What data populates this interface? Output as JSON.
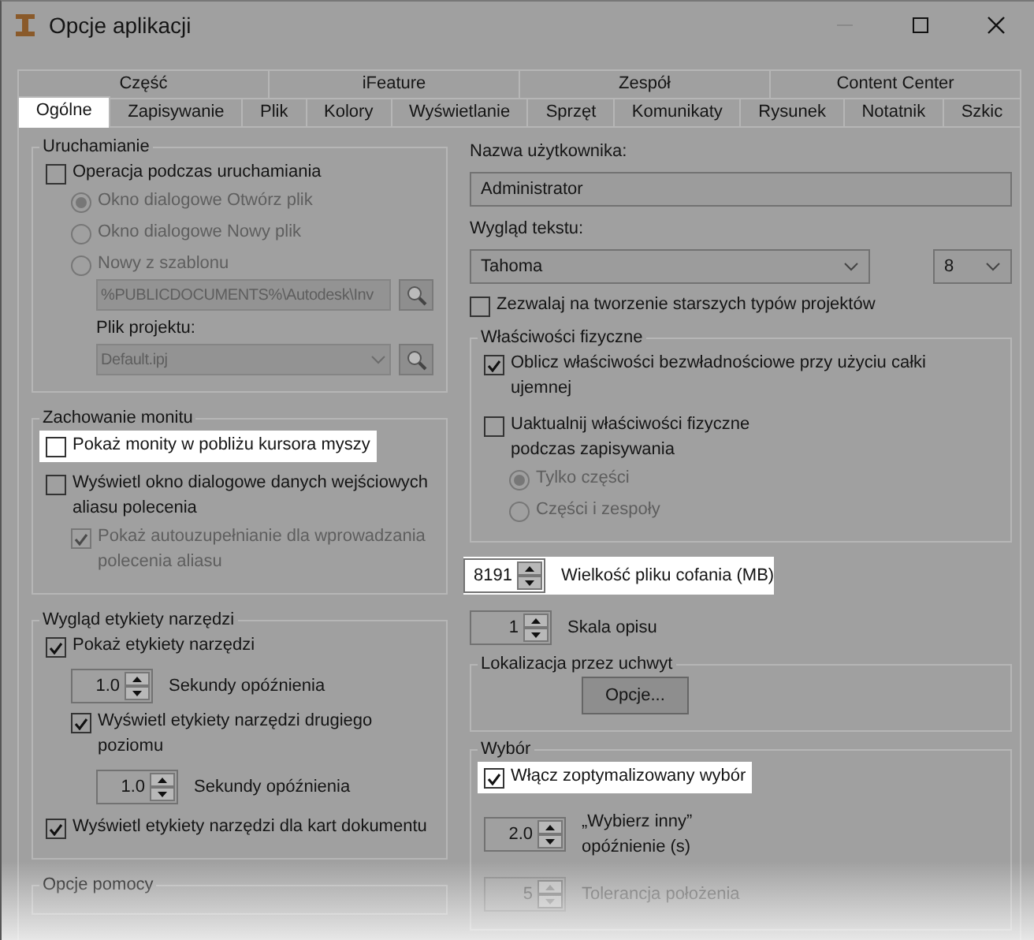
{
  "window": {
    "title": "Opcje aplikacji"
  },
  "tab_rows": [
    [
      {
        "label": "Część",
        "selected": false
      },
      {
        "label": "iFeature",
        "selected": false
      },
      {
        "label": "Zespół",
        "selected": false
      },
      {
        "label": "Content Center",
        "selected": false
      }
    ],
    [
      {
        "label": "Ogólne",
        "selected": true
      },
      {
        "label": "Zapisywanie",
        "selected": false
      },
      {
        "label": "Plik",
        "selected": false
      },
      {
        "label": "Kolory",
        "selected": false
      },
      {
        "label": "Wyświetlanie",
        "selected": false
      },
      {
        "label": "Sprzęt",
        "selected": false
      },
      {
        "label": "Komunikaty",
        "selected": false
      },
      {
        "label": "Rysunek",
        "selected": false
      },
      {
        "label": "Notatnik",
        "selected": false
      },
      {
        "label": "Szkic",
        "selected": false
      }
    ]
  ],
  "left_column": [
    {
      "kind": "group",
      "title": "Uruchamianie",
      "items": [
        {
          "kind": "checkbox",
          "label": "Operacja podczas uruchamiania",
          "checked": false,
          "children": [
            {
              "kind": "radio",
              "label": "Okno dialogowe Otwórz plik",
              "selected": true,
              "disabled": true
            },
            {
              "kind": "radio",
              "label": "Okno dialogowe Nowy plik",
              "selected": false,
              "disabled": true
            },
            {
              "kind": "radio",
              "label": "Nowy z szablonu",
              "selected": false,
              "disabled": true,
              "children": [
                {
                  "kind": "browse_field",
                  "value": "%PUBLICDOCUMENTS%\\Autodesk\\Inv"
                },
                {
                  "kind": "label",
                  "text": "Plik projektu:"
                },
                {
                  "kind": "browse_select",
                  "value": "Default.ipj"
                }
              ]
            }
          ]
        }
      ]
    },
    {
      "kind": "group",
      "title": "Zachowanie monitu",
      "items": [
        {
          "kind": "checkbox",
          "label": "Pokaż monity w pobliżu kursora myszy",
          "checked": false,
          "highlighted": true
        },
        {
          "kind": "checkbox",
          "label": "Wyświetl okno dialogowe danych wejściowych aliasu polecenia",
          "checked": false,
          "children": [
            {
              "kind": "checkbox",
              "label": "Pokaż autouzupełnianie dla wprowadzania polecenia aliasu",
              "checked": true,
              "disabled": true
            }
          ]
        }
      ]
    },
    {
      "kind": "group",
      "title": "Wygląd etykiety narzędzi",
      "items": [
        {
          "kind": "checkbox",
          "label": "Pokaż etykiety narzędzi",
          "checked": true,
          "children": [
            {
              "kind": "spinner",
              "value": "1.0",
              "label": "Sekundy opóźnienia"
            },
            {
              "kind": "checkbox",
              "label": "Wyświetl etykiety narzędzi drugiego poziomu",
              "checked": true,
              "children": [
                {
                  "kind": "spinner",
                  "value": "1.0",
                  "label": "Sekundy opóźnienia"
                }
              ]
            }
          ]
        },
        {
          "kind": "checkbox",
          "label": "Wyświetl etykiety narzędzi dla kart dokumentu",
          "checked": true
        }
      ]
    },
    {
      "kind": "group",
      "title": "Opcje pomocy"
    }
  ],
  "right_column": [
    {
      "kind": "label",
      "text": "Nazwa użytkownika:"
    },
    {
      "kind": "text_field",
      "value": "Administrator"
    },
    {
      "kind": "label",
      "text": "Wygląd tekstu:"
    },
    {
      "kind": "font_row",
      "font": "Tahoma",
      "size": "8"
    },
    {
      "kind": "checkbox",
      "label": "Zezwalaj na tworzenie starszych typów projektów",
      "checked": false
    },
    {
      "kind": "group",
      "title": "Właściwości fizyczne",
      "items": [
        {
          "kind": "checkbox",
          "label": "Oblicz właściwości bezwładnościowe przy użyciu całki ujemnej",
          "checked": true
        },
        {
          "kind": "checkbox",
          "label": "Uaktualnij właściwości fizyczne\npodczas zapisywania",
          "checked": false,
          "children": [
            {
              "kind": "radio",
              "label": "Tylko części",
              "selected": true,
              "disabled": true
            },
            {
              "kind": "radio",
              "label": "Części i zespoły",
              "selected": false,
              "disabled": true
            }
          ]
        }
      ]
    },
    {
      "kind": "spinner",
      "value": "8191",
      "label": "Wielkość pliku cofania (MB)",
      "highlighted": true
    },
    {
      "kind": "spinner",
      "value": "1",
      "label": "Skala opisu"
    },
    {
      "kind": "group",
      "title": "Lokalizacja przez uchwyt",
      "items": [
        {
          "kind": "button",
          "label": "Opcje..."
        }
      ]
    },
    {
      "kind": "group",
      "title": "Wybór",
      "items": [
        {
          "kind": "checkbox",
          "label": "Włącz zoptymalizowany wybór",
          "checked": true,
          "highlighted": true
        },
        {
          "kind": "spinner",
          "value": "2.0",
          "label": "„Wybierz inny”\nopóźnienie (s)"
        },
        {
          "kind": "spinner",
          "value": "5",
          "label": "Tolerancja położenia",
          "disabled": true
        }
      ]
    }
  ]
}
